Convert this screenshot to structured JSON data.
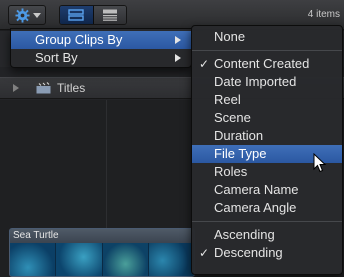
{
  "toolbar": {
    "items_count": "4 items"
  },
  "browser": {
    "titles_label": "Titles",
    "clip_name": "Sea Turtle"
  },
  "group_menu": {
    "items": [
      {
        "label": "Group Clips By",
        "highlighted": true,
        "submenu": true
      },
      {
        "label": "Sort By",
        "highlighted": false,
        "submenu": true
      }
    ]
  },
  "group_submenu": {
    "none": "None",
    "group_items": [
      {
        "label": "Content Created",
        "checked": true
      },
      {
        "label": "Date Imported",
        "checked": false
      },
      {
        "label": "Reel",
        "checked": false
      },
      {
        "label": "Scene",
        "checked": false
      },
      {
        "label": "Duration",
        "checked": false
      },
      {
        "label": "File Type",
        "checked": false,
        "highlighted": true
      },
      {
        "label": "Roles",
        "checked": false
      },
      {
        "label": "Camera Name",
        "checked": false
      },
      {
        "label": "Camera Angle",
        "checked": false
      }
    ],
    "order_items": [
      {
        "label": "Ascending",
        "checked": false
      },
      {
        "label": "Descending",
        "checked": true
      }
    ],
    "check_glyph": "✓"
  },
  "colors": {
    "highlight": "#3a67b0",
    "menu_bg": "#28292c"
  }
}
